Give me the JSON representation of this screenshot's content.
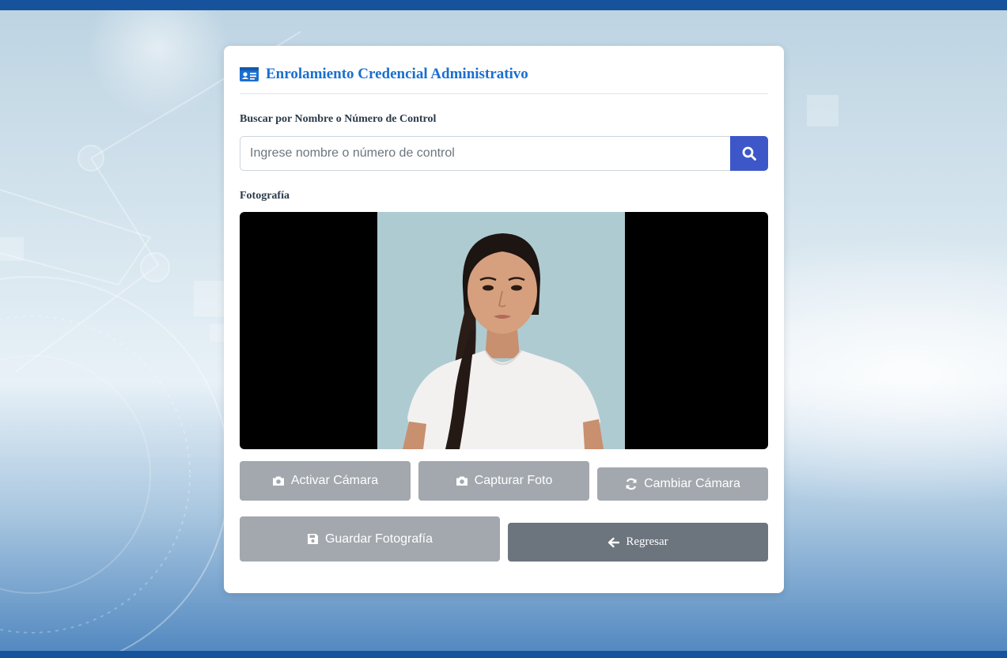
{
  "form": {
    "title": "Enrolamiento Credencial Administrativo",
    "search": {
      "label": "Buscar por Nombre o Número de Control",
      "placeholder": "Ingrese nombre o número de control",
      "value": ""
    },
    "photo": {
      "label": "Fotografía"
    },
    "buttons": {
      "activate_camera": "Activar Cámara",
      "capture_photo": "Capturar Foto",
      "switch_camera": "Cambiar Cámara",
      "save_photo": "Guardar Fotografía",
      "back": "Regresar"
    }
  },
  "icons": {
    "header": "id-card-icon",
    "search": "search-icon",
    "activate": "camera-icon",
    "capture": "camera-icon",
    "switch": "refresh-icon",
    "save": "floppy-disk-icon",
    "back": "arrow-left-icon"
  },
  "colors": {
    "brand_bar": "#17539c",
    "title": "#1a6fd0",
    "search_button": "#3d57c9",
    "button_light": "#a3a8ae",
    "button_dark": "#6c757d"
  }
}
